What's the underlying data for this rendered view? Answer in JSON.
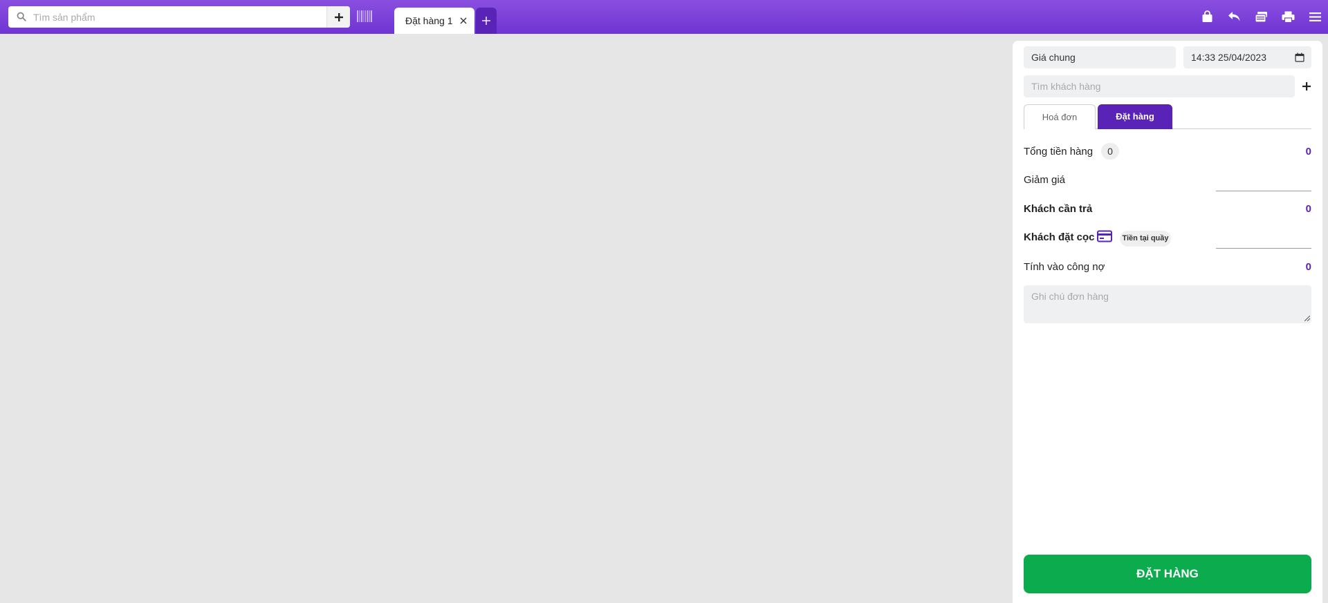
{
  "topbar": {
    "search_placeholder": "Tìm sản phẩm",
    "tabs": [
      {
        "label": "Đặt hàng 1",
        "active": true
      }
    ],
    "icons": [
      "bag-icon",
      "return-icon",
      "wallet-icon",
      "printer-icon",
      "menu-icon"
    ],
    "color_start": "#8a4fe0",
    "color_end": "#6f34d2"
  },
  "panel": {
    "price_list": "Giá chung",
    "datetime": "14:33 25/04/2023",
    "customer_placeholder": "Tìm khách hàng",
    "segments": [
      {
        "label": "Hoá đơn",
        "active": false
      },
      {
        "label": "Đặt hàng",
        "active": true
      }
    ],
    "rows": {
      "total_label": "Tổng tiền hàng",
      "total_count": "0",
      "total_value": "0",
      "discount_label": "Giảm giá",
      "pay_label": "Khách cần trả",
      "pay_value": "0",
      "deposit_label": "Khách đặt cọc",
      "deposit_method": "Tiền tại quầy",
      "debt_label": "Tính vào công nợ",
      "debt_value": "0"
    },
    "note_placeholder": "Ghi chú đơn hàng",
    "order_button": "ĐẶT HÀNG",
    "accent_color": "#5a23b8",
    "button_color": "#0bab4e"
  }
}
